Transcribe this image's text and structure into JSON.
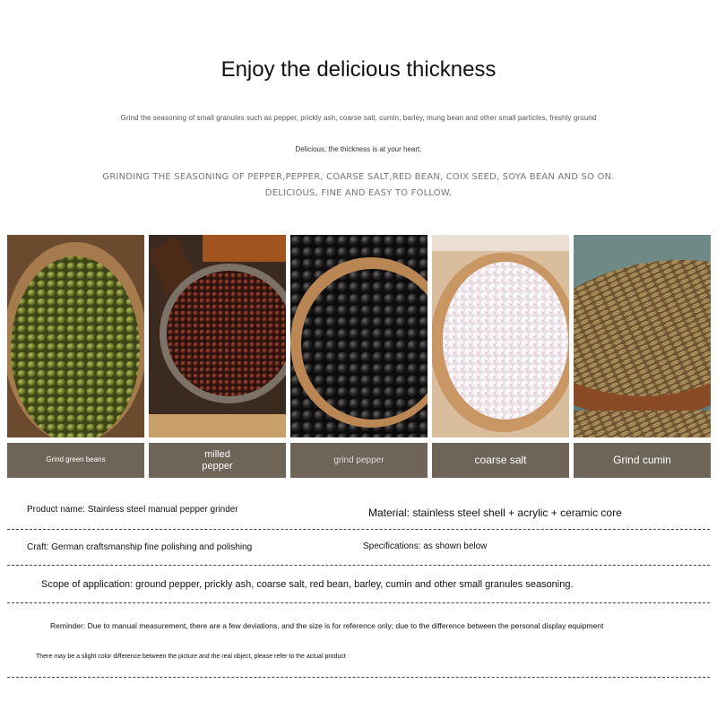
{
  "header": {
    "title": "Enjoy the delicious thickness",
    "line1": "Grind the seasoning of small granules such as pepper, prickly ash, coarse salt, cumin, barley, mung bean and other small particles, freshly ground",
    "line2": "Delicious, the thickness is at your heart.",
    "line3": "GRINDING THE SEASONING OF PEPPER,PEPPER, COARSE SALT,RED BEAN, COIX SEED, SOYA BEAN AND SO ON.",
    "line4": "DELICIOUS, FINE AND EASY TO FOLLOW."
  },
  "gallery": [
    {
      "caption": "Grind green beans",
      "icon": "mung-bean-photo"
    },
    {
      "caption": "milled pepper",
      "icon": "sichuan-pepper-photo"
    },
    {
      "caption": "grind pepper",
      "icon": "black-pepper-photo"
    },
    {
      "caption": "coarse salt",
      "icon": "coarse-salt-photo"
    },
    {
      "caption": "Grind cumin",
      "icon": "cumin-photo"
    }
  ],
  "specs": {
    "product_name": "Product name: Stainless steel manual pepper grinder",
    "material": "Material: stainless steel shell + acrylic + ceramic core",
    "craft": "Craft: German craftsmanship fine polishing and polishing",
    "specifications": "Specifications: as shown below",
    "scope": "Scope of application: ground pepper, prickly ash, coarse salt, red bean, barley, cumin and other small granules seasoning.",
    "reminder1": "Reminder: Due to manual measurement, there are a few deviations, and the size is for reference only; due to the difference between the personal display equipment",
    "reminder2": "There may be a slight color difference between the picture and the real object, please refer to the actual product"
  },
  "colors": {
    "caption_bg": "#6e6457",
    "mung_bean": "#6d7a2a",
    "sichuan_pepper": "#5a2418",
    "black_pepper": "#1e1c1c",
    "salt": "#f3eef0",
    "cumin": "#a08454"
  }
}
